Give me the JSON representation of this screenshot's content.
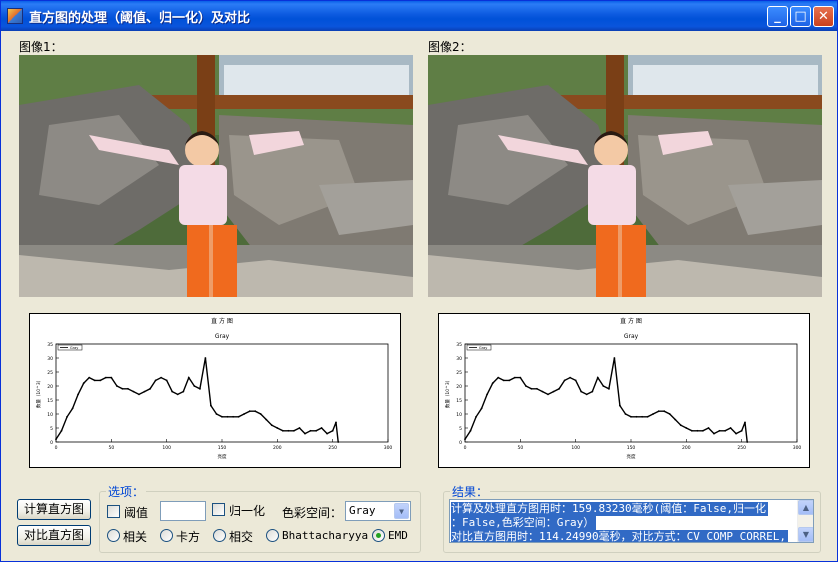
{
  "window": {
    "title": "直方图的处理（阈值、归一化）及对比"
  },
  "titlebar_buttons": {
    "minimize": "_",
    "maximize": "□",
    "close": "✕"
  },
  "images": [
    {
      "label": "图像1："
    },
    {
      "label": "图像2："
    }
  ],
  "histogram_panels": [
    {
      "title": "直 方 图",
      "subtitle": "Gray",
      "legend": "Gray",
      "ylabel": "数量（10^3）",
      "xlabel": "亮度"
    },
    {
      "title": "直 方 图",
      "subtitle": "Gray",
      "legend": "Gray",
      "ylabel": "数量（10^3）",
      "xlabel": "亮度"
    }
  ],
  "chart_data": [
    {
      "type": "line",
      "title": "直 方 图",
      "subtitle": "Gray",
      "xlabel": "亮度",
      "ylabel": "数量（10^3）",
      "xlim": [
        0,
        300
      ],
      "ylim": [
        0,
        35
      ],
      "xticks": [
        "0",
        "50",
        "100",
        "150",
        "200",
        "250",
        "300"
      ],
      "yticks": [
        "0",
        "5",
        "10",
        "15",
        "20",
        "25",
        "30",
        "35"
      ],
      "grid": false,
      "legend_position": "top-left",
      "series": [
        {
          "name": "Gray",
          "x": [
            0,
            5,
            10,
            15,
            20,
            25,
            30,
            35,
            40,
            45,
            50,
            55,
            60,
            65,
            70,
            75,
            80,
            85,
            90,
            95,
            100,
            105,
            110,
            115,
            120,
            125,
            130,
            135,
            140,
            145,
            150,
            155,
            160,
            165,
            170,
            175,
            180,
            185,
            190,
            195,
            200,
            205,
            210,
            215,
            220,
            225,
            230,
            235,
            240,
            245,
            250,
            253,
            255
          ],
          "values": [
            1,
            4,
            9,
            12,
            17,
            21,
            23,
            22,
            22,
            23,
            23,
            20,
            19,
            19,
            18,
            17,
            18,
            19,
            22,
            23,
            22,
            18,
            17,
            18,
            23,
            20,
            19,
            30,
            13,
            10,
            9,
            9,
            9,
            9,
            10,
            11,
            11,
            10,
            8,
            6,
            5,
            4,
            4,
            4,
            5,
            3,
            4,
            4,
            5,
            3,
            4,
            7,
            0
          ]
        }
      ]
    },
    {
      "type": "line",
      "title": "直 方 图",
      "subtitle": "Gray",
      "xlabel": "亮度",
      "ylabel": "数量（10^3）",
      "xlim": [
        0,
        300
      ],
      "ylim": [
        0,
        35
      ],
      "xticks": [
        "0",
        "50",
        "100",
        "150",
        "200",
        "250",
        "300"
      ],
      "yticks": [
        "0",
        "5",
        "10",
        "15",
        "20",
        "25",
        "30",
        "35"
      ],
      "grid": false,
      "legend_position": "top-left",
      "series": [
        {
          "name": "Gray",
          "x": [
            0,
            5,
            10,
            15,
            20,
            25,
            30,
            35,
            40,
            45,
            50,
            55,
            60,
            65,
            70,
            75,
            80,
            85,
            90,
            95,
            100,
            105,
            110,
            115,
            120,
            125,
            130,
            135,
            140,
            145,
            150,
            155,
            160,
            165,
            170,
            175,
            180,
            185,
            190,
            195,
            200,
            205,
            210,
            215,
            220,
            225,
            230,
            235,
            240,
            245,
            250,
            253,
            255
          ],
          "values": [
            1,
            4,
            9,
            12,
            17,
            21,
            23,
            22,
            22,
            23,
            23,
            20,
            19,
            19,
            18,
            17,
            18,
            19,
            22,
            23,
            22,
            18,
            17,
            18,
            23,
            20,
            19,
            30,
            13,
            10,
            9,
            9,
            9,
            9,
            10,
            11,
            11,
            10,
            8,
            6,
            5,
            4,
            4,
            4,
            5,
            3,
            4,
            4,
            5,
            3,
            4,
            7,
            0
          ]
        }
      ]
    }
  ],
  "actions": {
    "calc_hist": "计算直方图",
    "compare_hist": "对比直方图"
  },
  "options": {
    "group_title": "选项：",
    "threshold_label": "阈值",
    "threshold_checked": false,
    "threshold_value": "",
    "normalize_label": "归一化",
    "normalize_checked": false,
    "colorspace_label": "色彩空间：",
    "colorspace_value": "Gray",
    "compare_methods": [
      {
        "label": "相关",
        "checked": false
      },
      {
        "label": "卡方",
        "checked": false
      },
      {
        "label": "相交",
        "checked": false
      },
      {
        "label": "Bhattacharyya",
        "checked": false
      },
      {
        "label": "EMD",
        "checked": true
      }
    ]
  },
  "results": {
    "group_title": "结果：",
    "lines": [
      "计算及处理直方图用时：159.83230毫秒(阈值：False,归一化",
      "：False,色彩空间：Gray）",
      "对比直方图用时：114.24990毫秒，对比方式：CV_COMP_CORREL,"
    ]
  },
  "colors": {
    "title_bar": "#0054e3",
    "group_title": "#0046d5",
    "selection": "#316ac5",
    "window_bg": "#ece9d8"
  }
}
